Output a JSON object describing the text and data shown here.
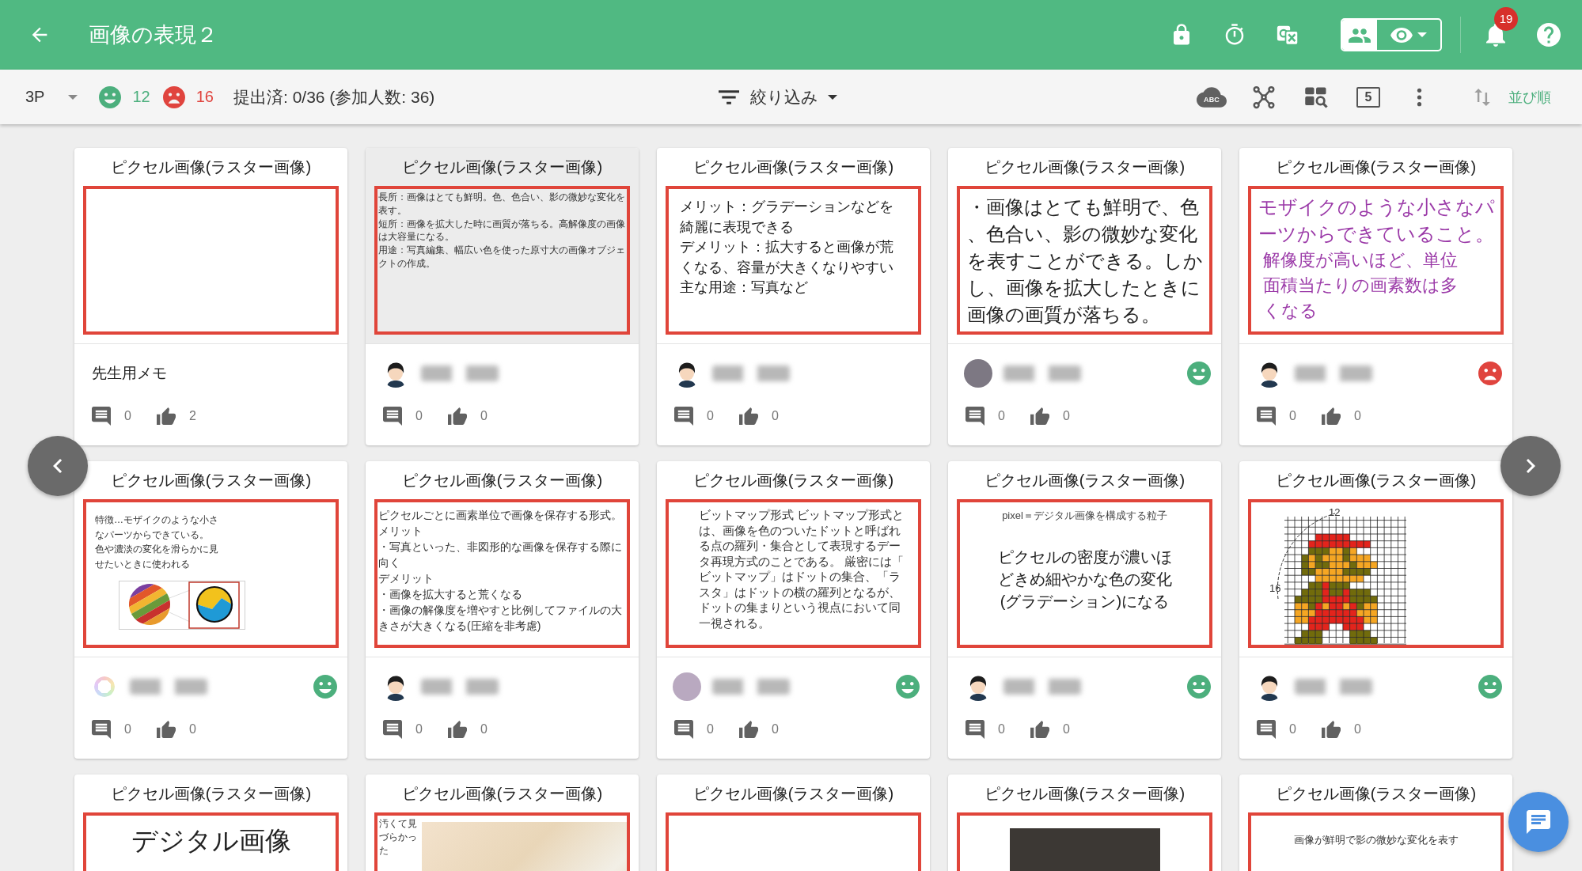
{
  "header": {
    "title": "画像の表現２",
    "view_toggle": [
      {
        "kind": "people",
        "selected": true
      },
      {
        "kind": "eye",
        "selected": false
      }
    ],
    "notification_count": "19"
  },
  "toolbar": {
    "class_select": "3P",
    "positive_count": "12",
    "negative_count": "16",
    "submission_status": "提出済: 0/36 (参加人数: 36)",
    "filter_label": "絞り込み",
    "cloud_label": "ABC",
    "column_count": "5",
    "sort_label": "並び順"
  },
  "cards": [
    {
      "title": "ピクセル画像(ラスター画像)",
      "highlighted": false,
      "content": {
        "kind": "blank"
      },
      "author": {
        "kind": "teacher_memo",
        "label": "先生用メモ"
      },
      "comments": "0",
      "likes": "2"
    },
    {
      "title": "ピクセル画像(ラスター画像)",
      "highlighted": true,
      "content": {
        "kind": "notes",
        "paragraphs": [
          {
            "text": "長所：画像はとても鮮明。色、色合い、影の微妙な変化を表す。"
          },
          {
            "text": "短所：画像を拡大した時に画質が落ちる。高解像度の画像は大容量になる。"
          },
          {
            "text": "用途：写真編集、幅広い色を使った原寸大の画像オブジェクトの作成。"
          }
        ]
      },
      "author": {
        "kind": "student",
        "avatar": {
          "kind": "boy"
        }
      },
      "comments": "0",
      "likes": "0"
    },
    {
      "title": "ピクセル画像(ラスター画像)",
      "highlighted": false,
      "content": {
        "kind": "memo",
        "paragraphs": [
          {
            "text": "メリット：グラデーションなどを綺麗に表現できる"
          },
          {
            "text": "デメリット：拡大すると画像が荒くなる、容量が大きくなりやすい"
          },
          {
            "text": "主な用途：写真など"
          }
        ]
      },
      "author": {
        "kind": "student",
        "avatar": {
          "kind": "boy"
        }
      },
      "comments": "0",
      "likes": "0"
    },
    {
      "title": "ピクセル画像(ラスター画像)",
      "highlighted": false,
      "content": {
        "kind": "statement",
        "paragraphs": [
          {
            "text": "・画像はとても鮮明で、色、色合い、影の微妙な変化を表すことができる。しかし、画像を拡大したときに画像の画質が落ちる。"
          }
        ]
      },
      "author": {
        "kind": "student",
        "avatar": {
          "kind": "photo"
        }
      },
      "reaction": {
        "kind": "smile"
      },
      "comments": "0",
      "likes": "0"
    },
    {
      "title": "ピクセル画像(ラスター画像)",
      "highlighted": false,
      "content": {
        "kind": "statement",
        "paragraphs": [
          {
            "text": "モザイクのような小さなパーツからできていること。",
            "color": "#9b3aa8"
          },
          {
            "text": "解像度が高いほど、単位面積当たりの画素数は多くなる",
            "color": "#9b3aa8"
          }
        ]
      },
      "author": {
        "kind": "student",
        "avatar": {
          "kind": "boy"
        }
      },
      "reaction": {
        "kind": "frown"
      },
      "comments": "0",
      "likes": "0"
    },
    {
      "title": "ピクセル画像(ラスター画像)",
      "highlighted": false,
      "content": {
        "kind": "slide",
        "paragraphs": [
          {
            "text": "特徴…モザイクのような小さなパーツからできている。"
          },
          {
            "text": "色や濃淡の変化を滑らかに見せたいときに使われる"
          }
        ]
      },
      "author": {
        "kind": "student",
        "avatar": {
          "kind": "rainbow"
        }
      },
      "reaction": {
        "kind": "smile"
      },
      "comments": "0",
      "likes": "0"
    },
    {
      "title": "ピクセル画像(ラスター画像)",
      "highlighted": false,
      "content": {
        "kind": "list",
        "paragraphs": [
          {
            "text": "ピクセルごとに画素単位で画像を保存する形式。"
          },
          {
            "text": "メリット"
          },
          {
            "text": "・写真といった、非図形的な画像を保存する際に向く"
          },
          {
            "text": "デメリット"
          },
          {
            "text": "・画像を拡大すると荒くなる"
          },
          {
            "text": "・画像の解像度を増やすと比例してファイルの大きさが大きくなる(圧縮を非考慮)"
          }
        ]
      },
      "author": {
        "kind": "student",
        "avatar": {
          "kind": "boy"
        }
      },
      "comments": "0",
      "likes": "0"
    },
    {
      "title": "ピクセル画像(ラスター画像)",
      "highlighted": false,
      "content": {
        "kind": "definition",
        "paragraphs": [
          {
            "text": "ビットマップ形式 ビットマップ形式とは、画像を色のついたドットと呼ばれる点の羅列・集合として表現するデータ再現方式のことである。 厳密には「ビットマップ」はドットの集合、「ラスタ」はドットの横の羅列となるが、ドットの集まりという視点において同一視される。"
          }
        ]
      },
      "author": {
        "kind": "student",
        "avatar": {
          "kind": "character"
        }
      },
      "reaction": {
        "kind": "smile"
      },
      "comments": "0",
      "likes": "0"
    },
    {
      "title": "ピクセル画像(ラスター画像)",
      "highlighted": false,
      "content": {
        "kind": "caption_and_statement",
        "paragraphs": [
          {
            "kind": "caption",
            "text": "pixel＝デジタル画像を構成する粒子"
          },
          {
            "kind": "body",
            "text": "ピクセルの密度が濃いほどきめ細やかな色の変化(グラデーション)になる"
          }
        ]
      },
      "author": {
        "kind": "student",
        "avatar": {
          "kind": "boy"
        }
      },
      "reaction": {
        "kind": "smile"
      },
      "comments": "0",
      "likes": "0"
    },
    {
      "title": "ピクセル画像(ラスター画像)",
      "highlighted": false,
      "content": {
        "kind": "pixel_figure",
        "top_label": "12",
        "side_label": "16"
      },
      "author": {
        "kind": "student",
        "avatar": {
          "kind": "boy"
        }
      },
      "reaction": {
        "kind": "smile"
      },
      "comments": "0",
      "likes": "0"
    },
    {
      "title": "ピクセル画像(ラスター画像)",
      "highlighted": false,
      "content": {
        "kind": "heading",
        "paragraphs": [
          {
            "text": "デジタル画像"
          }
        ]
      }
    },
    {
      "title": "ピクセル画像(ラスター画像)",
      "highlighted": false,
      "content": {
        "kind": "photo_with_note",
        "paragraphs": [
          {
            "text": "汚くて見づらかった"
          }
        ]
      }
    },
    {
      "title": "ピクセル画像(ラスター画像)",
      "highlighted": false,
      "content": {
        "kind": "blank"
      }
    },
    {
      "title": "ピクセル画像(ラスター画像)",
      "highlighted": false,
      "content": {
        "kind": "photo"
      }
    },
    {
      "title": "ピクセル画像(ラスター画像)",
      "highlighted": false,
      "content": {
        "kind": "caption",
        "paragraphs": [
          {
            "text": "画像が鮮明で影の微妙な変化を表す"
          }
        ]
      }
    }
  ]
}
